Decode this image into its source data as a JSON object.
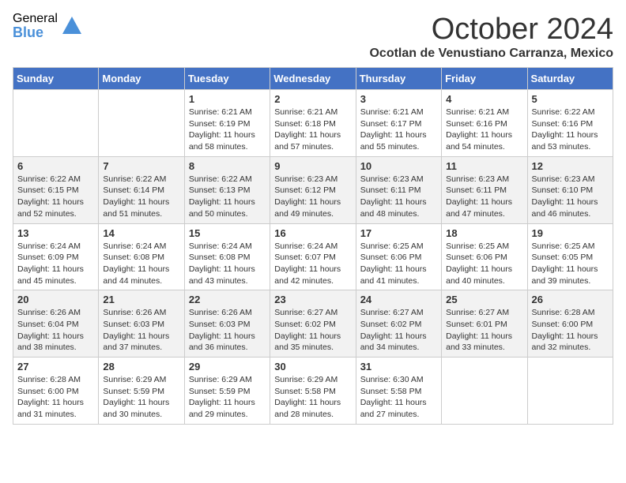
{
  "logo": {
    "general": "General",
    "blue": "Blue"
  },
  "title": "October 2024",
  "subtitle": "Ocotlan de Venustiano Carranza, Mexico",
  "days_of_week": [
    "Sunday",
    "Monday",
    "Tuesday",
    "Wednesday",
    "Thursday",
    "Friday",
    "Saturday"
  ],
  "weeks": [
    [
      {
        "day": "",
        "sunrise": "",
        "sunset": "",
        "daylight": ""
      },
      {
        "day": "",
        "sunrise": "",
        "sunset": "",
        "daylight": ""
      },
      {
        "day": "1",
        "sunrise": "Sunrise: 6:21 AM",
        "sunset": "Sunset: 6:19 PM",
        "daylight": "Daylight: 11 hours and 58 minutes."
      },
      {
        "day": "2",
        "sunrise": "Sunrise: 6:21 AM",
        "sunset": "Sunset: 6:18 PM",
        "daylight": "Daylight: 11 hours and 57 minutes."
      },
      {
        "day": "3",
        "sunrise": "Sunrise: 6:21 AM",
        "sunset": "Sunset: 6:17 PM",
        "daylight": "Daylight: 11 hours and 55 minutes."
      },
      {
        "day": "4",
        "sunrise": "Sunrise: 6:21 AM",
        "sunset": "Sunset: 6:16 PM",
        "daylight": "Daylight: 11 hours and 54 minutes."
      },
      {
        "day": "5",
        "sunrise": "Sunrise: 6:22 AM",
        "sunset": "Sunset: 6:16 PM",
        "daylight": "Daylight: 11 hours and 53 minutes."
      }
    ],
    [
      {
        "day": "6",
        "sunrise": "Sunrise: 6:22 AM",
        "sunset": "Sunset: 6:15 PM",
        "daylight": "Daylight: 11 hours and 52 minutes."
      },
      {
        "day": "7",
        "sunrise": "Sunrise: 6:22 AM",
        "sunset": "Sunset: 6:14 PM",
        "daylight": "Daylight: 11 hours and 51 minutes."
      },
      {
        "day": "8",
        "sunrise": "Sunrise: 6:22 AM",
        "sunset": "Sunset: 6:13 PM",
        "daylight": "Daylight: 11 hours and 50 minutes."
      },
      {
        "day": "9",
        "sunrise": "Sunrise: 6:23 AM",
        "sunset": "Sunset: 6:12 PM",
        "daylight": "Daylight: 11 hours and 49 minutes."
      },
      {
        "day": "10",
        "sunrise": "Sunrise: 6:23 AM",
        "sunset": "Sunset: 6:11 PM",
        "daylight": "Daylight: 11 hours and 48 minutes."
      },
      {
        "day": "11",
        "sunrise": "Sunrise: 6:23 AM",
        "sunset": "Sunset: 6:11 PM",
        "daylight": "Daylight: 11 hours and 47 minutes."
      },
      {
        "day": "12",
        "sunrise": "Sunrise: 6:23 AM",
        "sunset": "Sunset: 6:10 PM",
        "daylight": "Daylight: 11 hours and 46 minutes."
      }
    ],
    [
      {
        "day": "13",
        "sunrise": "Sunrise: 6:24 AM",
        "sunset": "Sunset: 6:09 PM",
        "daylight": "Daylight: 11 hours and 45 minutes."
      },
      {
        "day": "14",
        "sunrise": "Sunrise: 6:24 AM",
        "sunset": "Sunset: 6:08 PM",
        "daylight": "Daylight: 11 hours and 44 minutes."
      },
      {
        "day": "15",
        "sunrise": "Sunrise: 6:24 AM",
        "sunset": "Sunset: 6:08 PM",
        "daylight": "Daylight: 11 hours and 43 minutes."
      },
      {
        "day": "16",
        "sunrise": "Sunrise: 6:24 AM",
        "sunset": "Sunset: 6:07 PM",
        "daylight": "Daylight: 11 hours and 42 minutes."
      },
      {
        "day": "17",
        "sunrise": "Sunrise: 6:25 AM",
        "sunset": "Sunset: 6:06 PM",
        "daylight": "Daylight: 11 hours and 41 minutes."
      },
      {
        "day": "18",
        "sunrise": "Sunrise: 6:25 AM",
        "sunset": "Sunset: 6:06 PM",
        "daylight": "Daylight: 11 hours and 40 minutes."
      },
      {
        "day": "19",
        "sunrise": "Sunrise: 6:25 AM",
        "sunset": "Sunset: 6:05 PM",
        "daylight": "Daylight: 11 hours and 39 minutes."
      }
    ],
    [
      {
        "day": "20",
        "sunrise": "Sunrise: 6:26 AM",
        "sunset": "Sunset: 6:04 PM",
        "daylight": "Daylight: 11 hours and 38 minutes."
      },
      {
        "day": "21",
        "sunrise": "Sunrise: 6:26 AM",
        "sunset": "Sunset: 6:03 PM",
        "daylight": "Daylight: 11 hours and 37 minutes."
      },
      {
        "day": "22",
        "sunrise": "Sunrise: 6:26 AM",
        "sunset": "Sunset: 6:03 PM",
        "daylight": "Daylight: 11 hours and 36 minutes."
      },
      {
        "day": "23",
        "sunrise": "Sunrise: 6:27 AM",
        "sunset": "Sunset: 6:02 PM",
        "daylight": "Daylight: 11 hours and 35 minutes."
      },
      {
        "day": "24",
        "sunrise": "Sunrise: 6:27 AM",
        "sunset": "Sunset: 6:02 PM",
        "daylight": "Daylight: 11 hours and 34 minutes."
      },
      {
        "day": "25",
        "sunrise": "Sunrise: 6:27 AM",
        "sunset": "Sunset: 6:01 PM",
        "daylight": "Daylight: 11 hours and 33 minutes."
      },
      {
        "day": "26",
        "sunrise": "Sunrise: 6:28 AM",
        "sunset": "Sunset: 6:00 PM",
        "daylight": "Daylight: 11 hours and 32 minutes."
      }
    ],
    [
      {
        "day": "27",
        "sunrise": "Sunrise: 6:28 AM",
        "sunset": "Sunset: 6:00 PM",
        "daylight": "Daylight: 11 hours and 31 minutes."
      },
      {
        "day": "28",
        "sunrise": "Sunrise: 6:29 AM",
        "sunset": "Sunset: 5:59 PM",
        "daylight": "Daylight: 11 hours and 30 minutes."
      },
      {
        "day": "29",
        "sunrise": "Sunrise: 6:29 AM",
        "sunset": "Sunset: 5:59 PM",
        "daylight": "Daylight: 11 hours and 29 minutes."
      },
      {
        "day": "30",
        "sunrise": "Sunrise: 6:29 AM",
        "sunset": "Sunset: 5:58 PM",
        "daylight": "Daylight: 11 hours and 28 minutes."
      },
      {
        "day": "31",
        "sunrise": "Sunrise: 6:30 AM",
        "sunset": "Sunset: 5:58 PM",
        "daylight": "Daylight: 11 hours and 27 minutes."
      },
      {
        "day": "",
        "sunrise": "",
        "sunset": "",
        "daylight": ""
      },
      {
        "day": "",
        "sunrise": "",
        "sunset": "",
        "daylight": ""
      }
    ]
  ]
}
